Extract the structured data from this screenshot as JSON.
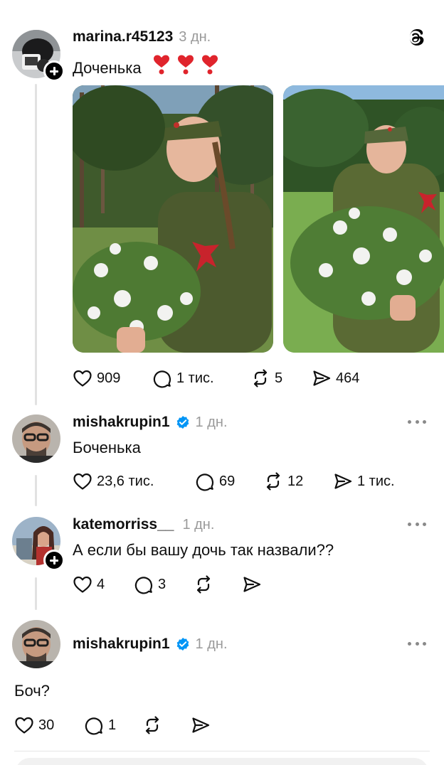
{
  "post": {
    "username": "marina.r45123",
    "time": "3 дн.",
    "text": "Доченька",
    "likes": "909",
    "replies": "1 тис.",
    "reposts": "5",
    "shares": "464"
  },
  "comments": [
    {
      "username": "mishakrupin1",
      "verified": true,
      "time": "1 дн.",
      "text": "Боченька",
      "likes": "23,6 тис.",
      "replies": "69",
      "reposts": "12",
      "shares": "1 тис."
    },
    {
      "username": "katemorriss__",
      "verified": false,
      "time": "1 дн.",
      "text": "А если бы вашу дочь так назвали??",
      "likes": "4",
      "replies": "3",
      "reposts": "",
      "shares": ""
    },
    {
      "username": "mishakrupin1",
      "verified": true,
      "time": "1 дн.",
      "text": "Боч?",
      "likes": "30",
      "replies": "1",
      "reposts": "",
      "shares": ""
    }
  ],
  "icons": {
    "like": "heart-icon",
    "reply": "speech-bubble-icon",
    "repost": "repost-icon",
    "share": "send-icon",
    "emoji": "red-exclamation-heart",
    "app": "threads-logo"
  },
  "colors": {
    "verified": "#0095f6",
    "emoji_heart": "#e0242c",
    "muted_text": "#9a9a9a",
    "thread_line": "#e2e2e2"
  }
}
